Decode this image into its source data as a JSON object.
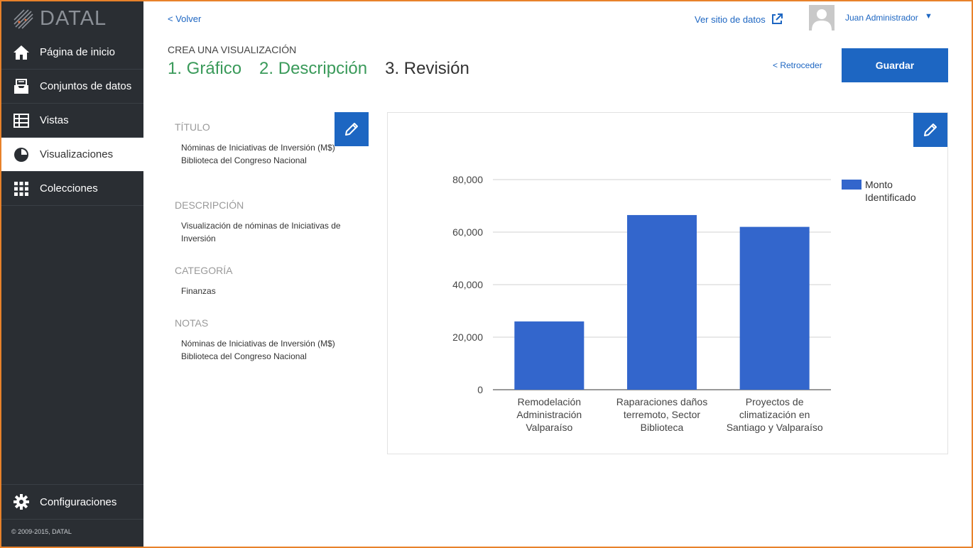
{
  "sidebar": {
    "logo_text": "DATAL",
    "items": [
      {
        "label": "Página de inicio",
        "icon": "home-icon"
      },
      {
        "label": "Conjuntos de datos",
        "icon": "inbox-icon"
      },
      {
        "label": "Vistas",
        "icon": "table-icon"
      },
      {
        "label": "Visualizaciones",
        "icon": "pie-chart-icon",
        "active": true
      },
      {
        "label": "Colecciones",
        "icon": "grid-icon"
      }
    ],
    "settings_label": "Configuraciones",
    "copyright": "© 2009-2015, DATAL"
  },
  "header": {
    "back_label": "< Volver",
    "site_link_label": "Ver sitio de datos",
    "user_name": "Juan Administrador",
    "user_caret": "▼"
  },
  "wizard": {
    "heading": "CREA UNA VISUALIZACIÓN",
    "steps": [
      "1. Gráfico",
      "2. Descripción",
      "3. Revisión"
    ],
    "back_step_label": "< Retroceder",
    "save_label": "Guardar"
  },
  "metadata": {
    "title_label": "TÍTULO",
    "title_value": "Nóminas de Iniciativas de Inversión (M$) Biblioteca del Congreso Nacional",
    "description_label": "DESCRIPCIÓN",
    "description_value": "Visualización de nóminas de Iniciativas de Inversión",
    "category_label": "CATEGORÍA",
    "category_value": "Finanzas",
    "notes_label": "NOTAS",
    "notes_value": "Nóminas de Iniciativas de Inversión (M$) Biblioteca del Congreso Nacional"
  },
  "colors": {
    "accent": "#1d66c2",
    "sidebar_bg": "#2a2e33",
    "step_done": "#3a9a5a",
    "bar": "#3366cc"
  },
  "chart_data": {
    "type": "bar",
    "categories": [
      [
        "Remodelación",
        "Administración",
        "Valparaíso"
      ],
      [
        "Raparaciones daños",
        "terremoto, Sector",
        "Biblioteca"
      ],
      [
        "Proyectos de",
        "climatización en",
        "Santiago y Valparaíso"
      ]
    ],
    "series": [
      {
        "name": "Monto Identificado",
        "legend_lines": [
          "Monto",
          "Identificado"
        ],
        "values": [
          26000,
          66500,
          62000
        ]
      }
    ],
    "yticks": [
      "0",
      "20,000",
      "40,000",
      "60,000",
      "80,000"
    ],
    "ylim": [
      0,
      80000
    ],
    "grid": true,
    "legend_position": "right"
  }
}
